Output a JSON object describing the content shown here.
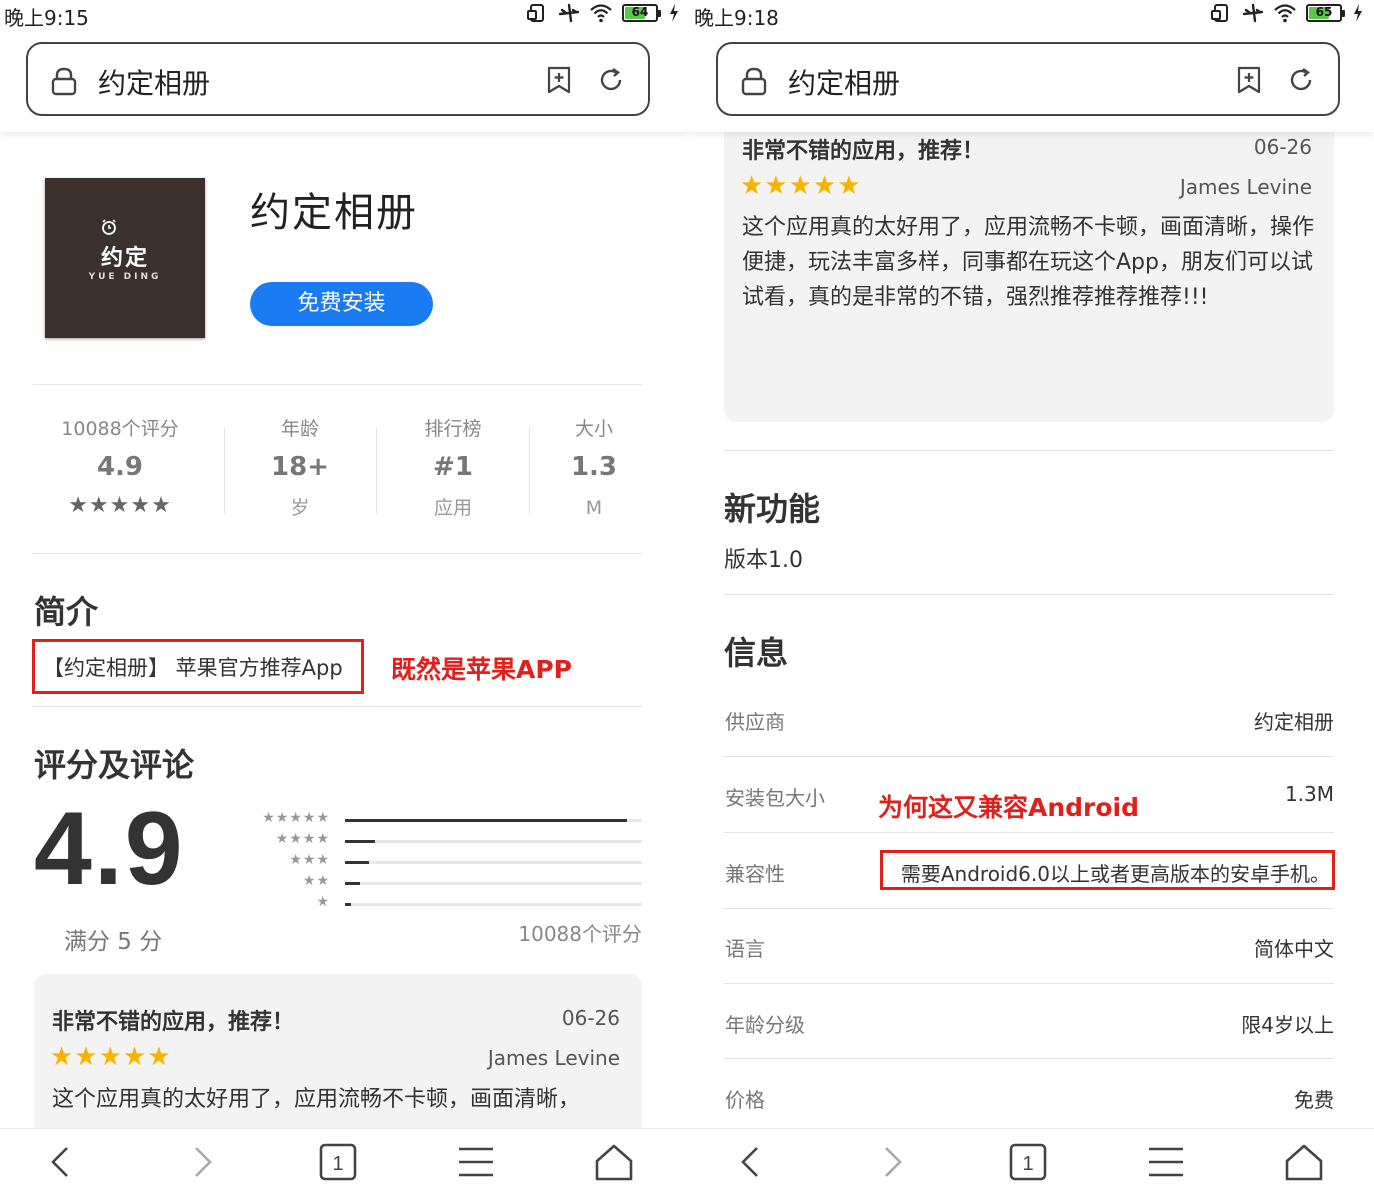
{
  "left": {
    "status": {
      "time": "晚上9:15",
      "battery": "64"
    },
    "urlbar": {
      "title": "约定相册"
    },
    "app": {
      "name": "约定相册",
      "icon_text": "约定",
      "icon_sub": "YUE DING",
      "install_label": "免费安装"
    },
    "stats": [
      {
        "label": "10088个评分",
        "value": "4.9",
        "sub": "★★★★★"
      },
      {
        "label": "年龄",
        "value": "18+",
        "sub": "岁"
      },
      {
        "label": "排行榜",
        "value": "#1",
        "sub": "应用"
      },
      {
        "label": "大小",
        "value": "1.3",
        "sub": "M"
      }
    ],
    "intro": {
      "title": "简介",
      "text": "【约定相册】 苹果官方推荐App",
      "annotation": "既然是苹果APP"
    },
    "ratings": {
      "title": "评分及评论",
      "score": "4.9",
      "max_text": "满分 5 分",
      "count_text": "10088个评分",
      "histogram": [
        {
          "stars": "★★★★★",
          "fraction": 0.95
        },
        {
          "stars": "★★★★",
          "fraction": 0.1
        },
        {
          "stars": "★★★",
          "fraction": 0.08
        },
        {
          "stars": "★★",
          "fraction": 0.05
        },
        {
          "stars": "★",
          "fraction": 0.02
        }
      ]
    },
    "review": {
      "title": "非常不错的应用，推荐！",
      "date": "06-26",
      "stars": "★★★★★",
      "author": "James Levine",
      "body": "这个应用真的太好用了，应用流畅不卡顿，画面清晰，"
    }
  },
  "right": {
    "status": {
      "time": "晚上9:18",
      "battery": "65"
    },
    "urlbar": {
      "title": "约定相册"
    },
    "review": {
      "title": "非常不错的应用，推荐！",
      "date": "06-26",
      "stars": "★★★★★",
      "author": "James Levine",
      "body": "这个应用真的太好用了，应用流畅不卡顿，画面清晰，操作便捷，玩法丰富多样，同事都在玩这个App，朋友们可以试试看，真的是非常的不错，强烈推荐推荐推荐!!!"
    },
    "whats_new": {
      "title": "新功能",
      "version": "版本1.0"
    },
    "info": {
      "title": "信息",
      "annotation": "为何这又兼容Android",
      "rows": [
        {
          "label": "供应商",
          "value": "约定相册"
        },
        {
          "label": "安装包大小",
          "value": "1.3M"
        },
        {
          "label": "兼容性",
          "value": "需要Android6.0以上或者更高版本的安卓手机。"
        },
        {
          "label": "语言",
          "value": "简体中文"
        },
        {
          "label": "年龄分级",
          "value": "限4岁以上"
        },
        {
          "label": "价格",
          "value": "免费"
        }
      ]
    }
  },
  "colors": {
    "accent": "#1a7bf2",
    "annotation_red": "#e0201c",
    "star_gold": "#f6b400"
  },
  "icons": [
    "lock-icon",
    "bookmark-add-icon",
    "reload-icon",
    "back-icon",
    "forward-icon",
    "tabs-icon",
    "menu-icon",
    "home-icon",
    "wifi-icon",
    "airplane-icon",
    "rotate-icon",
    "charging-icon"
  ]
}
